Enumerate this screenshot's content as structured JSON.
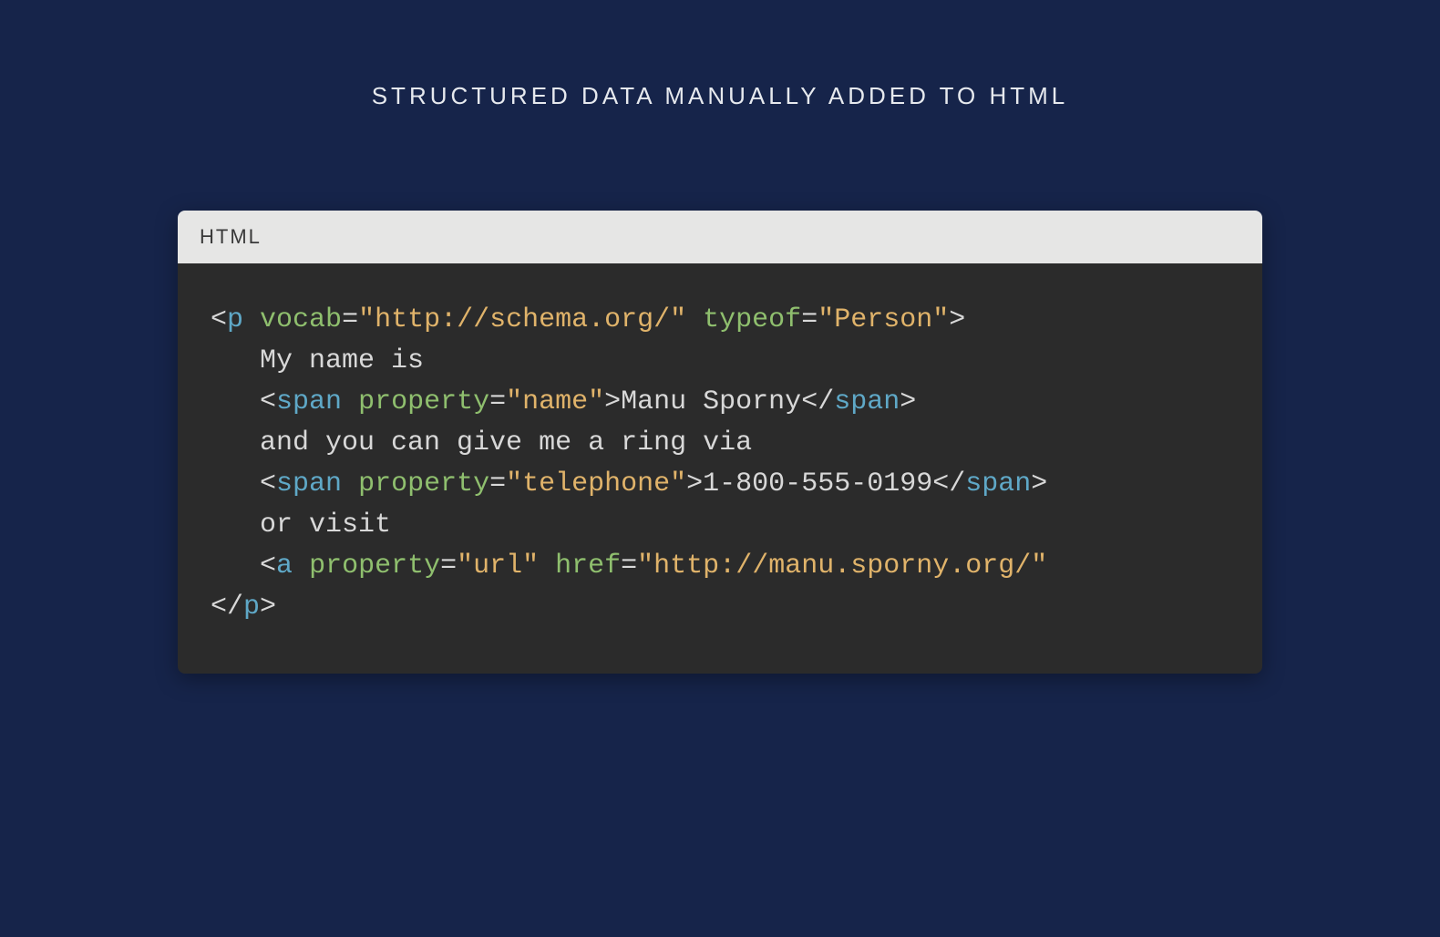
{
  "heading": "STRUCTURED DATA MANUALLY ADDED TO HTML",
  "code_header": "HTML",
  "code": {
    "line1": {
      "open": "<",
      "tag": "p",
      "sp1": " ",
      "attr1": "vocab",
      "eq1": "=",
      "val1": "\"http://schema.org/\"",
      "sp2": " ",
      "attr2": "typeof",
      "eq2": "=",
      "val2": "\"Person\"",
      "close": ">"
    },
    "line2": {
      "indent": "   ",
      "text": "My name is"
    },
    "line3": {
      "indent": "   ",
      "open": "<",
      "tag": "span",
      "sp": " ",
      "attr": "property",
      "eq": "=",
      "val": "\"name\"",
      "close": ">",
      "text": "Manu Sporny",
      "copen": "</",
      "ctag": "span",
      "cclose": ">"
    },
    "line4": {
      "indent": "   ",
      "text": "and you can give me a ring via"
    },
    "line5": {
      "indent": "   ",
      "open": "<",
      "tag": "span",
      "sp": " ",
      "attr": "property",
      "eq": "=",
      "val": "\"telephone\"",
      "close": ">",
      "text": "1-800-555-0199",
      "copen": "</",
      "ctag": "span",
      "cclose": ">"
    },
    "line6": {
      "indent": "   ",
      "text": "or visit"
    },
    "line7": {
      "indent": "   ",
      "open": "<",
      "tag": "a",
      "sp1": " ",
      "attr1": "property",
      "eq1": "=",
      "val1": "\"url\"",
      "sp2": " ",
      "attr2": "href",
      "eq2": "=",
      "val2": "\"http://manu.sporny.org/\""
    },
    "line8": {
      "open": "</",
      "tag": "p",
      "close": ">"
    }
  }
}
